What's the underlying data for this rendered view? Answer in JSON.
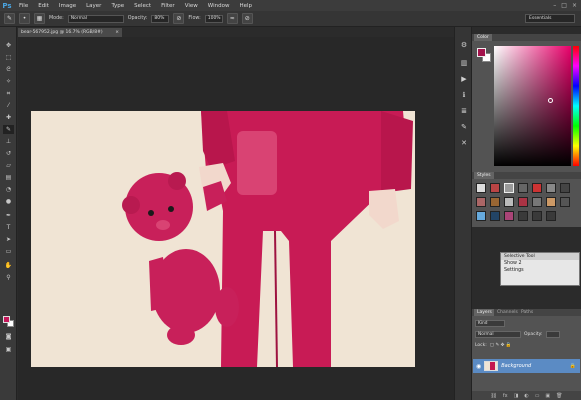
{
  "app": {
    "logo": "Ps"
  },
  "menu": [
    "File",
    "Edit",
    "Image",
    "Layer",
    "Type",
    "Select",
    "Filter",
    "View",
    "Window",
    "Help"
  ],
  "window_controls": [
    "–",
    "□",
    "×"
  ],
  "options": {
    "mode_label": "Mode:",
    "mode_value": "Normal",
    "opacity_label": "Opacity:",
    "opacity_value": "80%",
    "flow_label": "Flow:",
    "flow_value": "100%",
    "workspace": "Essentials"
  },
  "document": {
    "tab_title": "bear-567952.jpg @ 16.7% (RGB/8#)",
    "close": "×"
  },
  "panels": {
    "color_tab": "Color",
    "styles_tab": "Styles",
    "layers_tabs": [
      "Layers",
      "Channels",
      "Paths"
    ],
    "kind_filter": "Kind",
    "blend_mode": "Normal",
    "opacity_label": "Opacity:",
    "lock_label": "Lock:",
    "layer_name": "Background"
  },
  "selective_tool": {
    "title": "Selective Tool",
    "item1": "Show 2",
    "item2": "Settings"
  },
  "colors": {
    "foreground": "#c4175a",
    "background": "#ffffff",
    "accent": "#5b8bc4"
  },
  "icons": {
    "tools": [
      "move-icon",
      "marquee-icon",
      "lasso-icon",
      "quick-select-icon",
      "crop-icon",
      "eyedropper-icon",
      "healing-icon",
      "brush-icon",
      "stamp-icon",
      "history-brush-icon",
      "eraser-icon",
      "gradient-icon",
      "blur-icon",
      "dodge-icon",
      "pen-icon",
      "type-icon",
      "path-select-icon",
      "shape-icon",
      "hand-icon",
      "zoom-icon"
    ]
  }
}
